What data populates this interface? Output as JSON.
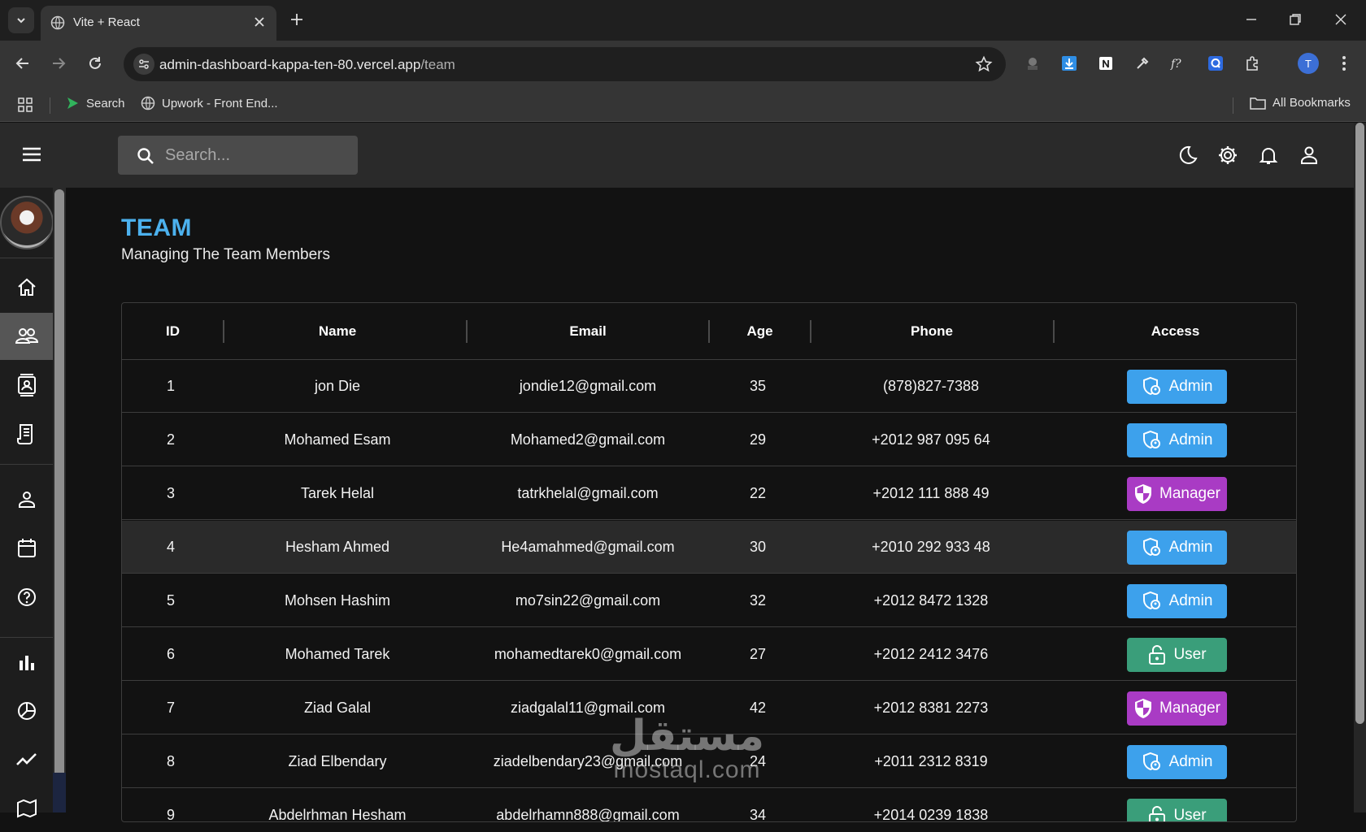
{
  "browser": {
    "tab_title": "Vite + React",
    "url_host": "admin-dashboard-kappa-ten-80.vercel.app",
    "url_path": "/team",
    "profile_initial": "T",
    "bookmarks": [
      {
        "label": "Search",
        "icon": "green-arrow-icon"
      },
      {
        "label": "Upwork - Front End...",
        "icon": "globe-icon"
      }
    ],
    "all_bookmarks_label": "All Bookmarks"
  },
  "topbar": {
    "search_placeholder": "Search...",
    "icons": [
      "moon-icon",
      "gear-icon",
      "bell-icon",
      "person-icon"
    ]
  },
  "sidebar": {
    "active_index": 1,
    "items": [
      "home-icon",
      "team-icon",
      "contacts-icon",
      "invoices-icon",
      "profile-icon",
      "calendar-icon",
      "help-icon",
      "bar-chart-icon",
      "pie-chart-icon",
      "line-chart-icon",
      "map-icon"
    ]
  },
  "page": {
    "title": "TEAM",
    "subtitle": "Managing The Team Members"
  },
  "table": {
    "columns": [
      "ID",
      "Name",
      "Email",
      "Age",
      "Phone",
      "Access"
    ],
    "highlighted_row": 3,
    "rows": [
      {
        "id": "1",
        "name": "jon Die",
        "email": "jondie12@gmail.com",
        "age": "35",
        "phone": "(878)827-7388",
        "access": "Admin"
      },
      {
        "id": "2",
        "name": "Mohamed Esam",
        "email": "Mohamed2@gmail.com",
        "age": "29",
        "phone": "+2012 987 095 64",
        "access": "Admin"
      },
      {
        "id": "3",
        "name": "Tarek Helal",
        "email": "tatrkhelal@gmail.com",
        "age": "22",
        "phone": "+2012 111 888 49",
        "access": "Manager"
      },
      {
        "id": "4",
        "name": "Hesham Ahmed",
        "email": "He4amahmed@gmail.com",
        "age": "30",
        "phone": "+2010 292 933 48",
        "access": "Admin"
      },
      {
        "id": "5",
        "name": "Mohsen Hashim",
        "email": "mo7sin22@gmail.com",
        "age": "32",
        "phone": "+2012 8472 1328",
        "access": "Admin"
      },
      {
        "id": "6",
        "name": "Mohamed Tarek",
        "email": "mohamedtarek0@gmail.com",
        "age": "27",
        "phone": "+2012 2412 3476",
        "access": "User"
      },
      {
        "id": "7",
        "name": "Ziad Galal",
        "email": "ziadgalal11@gmail.com",
        "age": "42",
        "phone": "+2012 8381 2273",
        "access": "Manager"
      },
      {
        "id": "8",
        "name": "Ziad Elbendary",
        "email": "ziadelbendary23@gmail.com",
        "age": "24",
        "phone": "+2011 2312 8319",
        "access": "Admin"
      },
      {
        "id": "9",
        "name": "Abdelrhman Hesham",
        "email": "abdelrhamn888@gmail.com",
        "age": "34",
        "phone": "+2014 0239 1838",
        "access": "User"
      }
    ]
  },
  "access_colors": {
    "Admin": "#3da1ec",
    "Manager": "#a93bc4",
    "User": "#3a9e7a"
  },
  "watermark": {
    "arabic": "مستقل",
    "latin": "mostaql.com"
  }
}
